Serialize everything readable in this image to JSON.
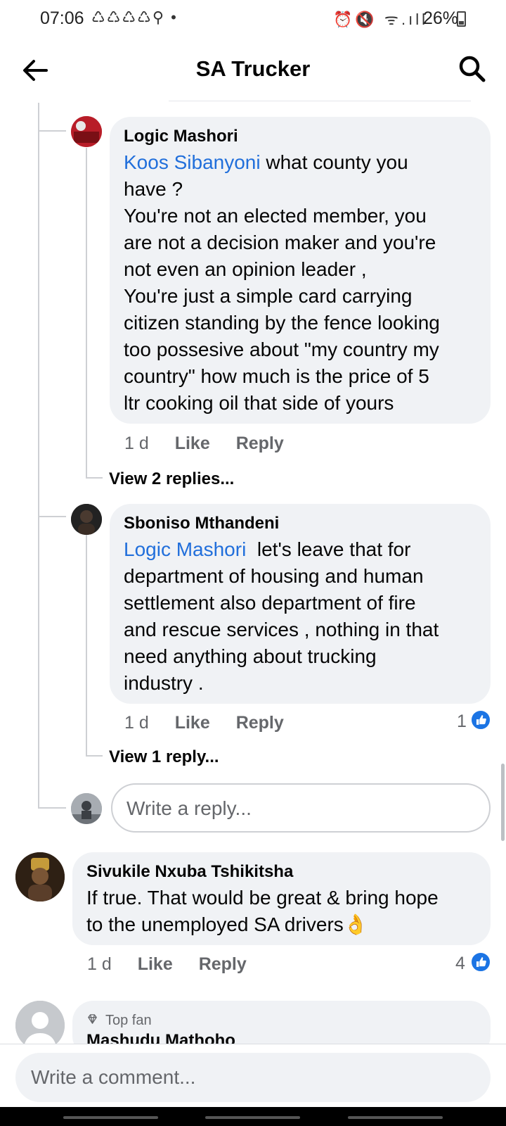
{
  "status_bar": {
    "time": "07:06",
    "left_icons": "♺♺♺♺⚲ •",
    "right_icons": "⏰🔇 ᯤ.ıll",
    "battery": "26%"
  },
  "header": {
    "title": "SA Trucker"
  },
  "comments": [
    {
      "author": "Logic Mashori",
      "mention": "Koos Sibanyoni",
      "text": " what county you\nhave ?\nYou're not an elected member, you\nare not a decision maker and you're\nnot even an opinion leader ,\nYou're just a simple card carrying\ncitizen standing by the fence looking\ntoo possesive about \"my country my\ncountry\" how much is the price of 5\nltr cooking oil that side of yours",
      "time": "1 d",
      "like": "Like",
      "reply": "Reply",
      "view_replies": "View 2 replies..."
    },
    {
      "author": "Sboniso Mthandeni",
      "mention": "Logic Mashori",
      "text": "  let's leave that for\ndepartment of housing and human\nsettlement also department of fire\nand rescue services , nothing in that\nneed anything about trucking\nindustry .",
      "time": "1 d",
      "like": "Like",
      "reply": "Reply",
      "like_count": "1",
      "view_replies": "View 1 reply..."
    },
    {
      "author": "Sivukile Nxuba Tshikitsha",
      "text": "If true. That would be great & bring hope\nto the unemployed SA drivers👌",
      "time": "1 d",
      "like": "Like",
      "reply": "Reply",
      "like_count": "4"
    },
    {
      "badge": "Top fan",
      "author": "Mashudu Mathoho"
    }
  ],
  "reply_box": {
    "placeholder": "Write a reply..."
  },
  "comment_box": {
    "placeholder": "Write a comment..."
  },
  "colors": {
    "mention": "#216fdb",
    "like_blue": "#1b74e4",
    "bubble": "#f0f2f5"
  }
}
